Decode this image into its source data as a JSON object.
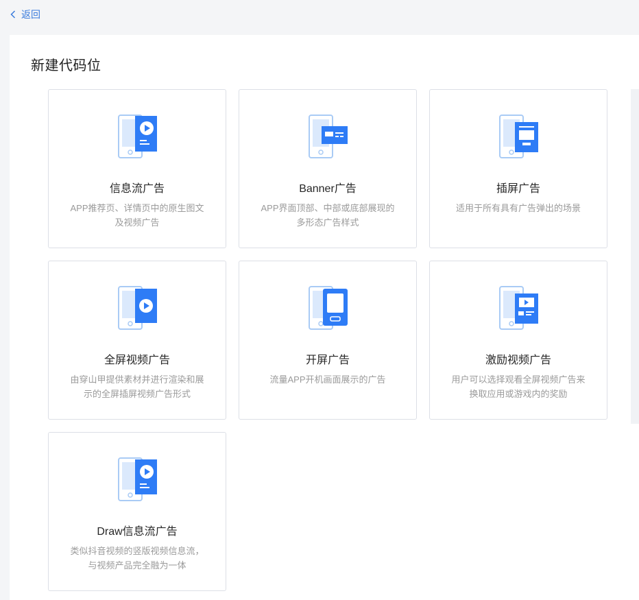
{
  "nav": {
    "back_label": "返回"
  },
  "page": {
    "title": "新建代码位"
  },
  "colors": {
    "accent": "#2e7cf6",
    "phone_outline": "#a9cbf5",
    "phone_screen": "#dbe9fc"
  },
  "cards": [
    {
      "title": "信息流广告",
      "desc": "APP推荐页、详情页中的原生图文及视频广告",
      "icon": "feed-ad-icon"
    },
    {
      "title": "Banner广告",
      "desc": "APP界面顶部、中部或底部展现的多形态广告样式",
      "icon": "banner-ad-icon"
    },
    {
      "title": "插屏广告",
      "desc": "适用于所有具有广告弹出的场景",
      "icon": "interstitial-ad-icon"
    },
    {
      "title": "全屏视频广告",
      "desc": "由穿山甲提供素材并进行渲染和展示的全屏插屏视频广告形式",
      "icon": "fullscreen-video-ad-icon"
    },
    {
      "title": "开屏广告",
      "desc": "流量APP开机画面展示的广告",
      "icon": "splash-ad-icon"
    },
    {
      "title": "激励视频广告",
      "desc": "用户可以选择观看全屏视频广告来换取应用或游戏内的奖励",
      "icon": "rewarded-video-ad-icon"
    },
    {
      "title": "Draw信息流广告",
      "desc": "类似抖音视频的竖版视频信息流，与视频产品完全融为一体",
      "icon": "draw-feed-ad-icon"
    }
  ]
}
